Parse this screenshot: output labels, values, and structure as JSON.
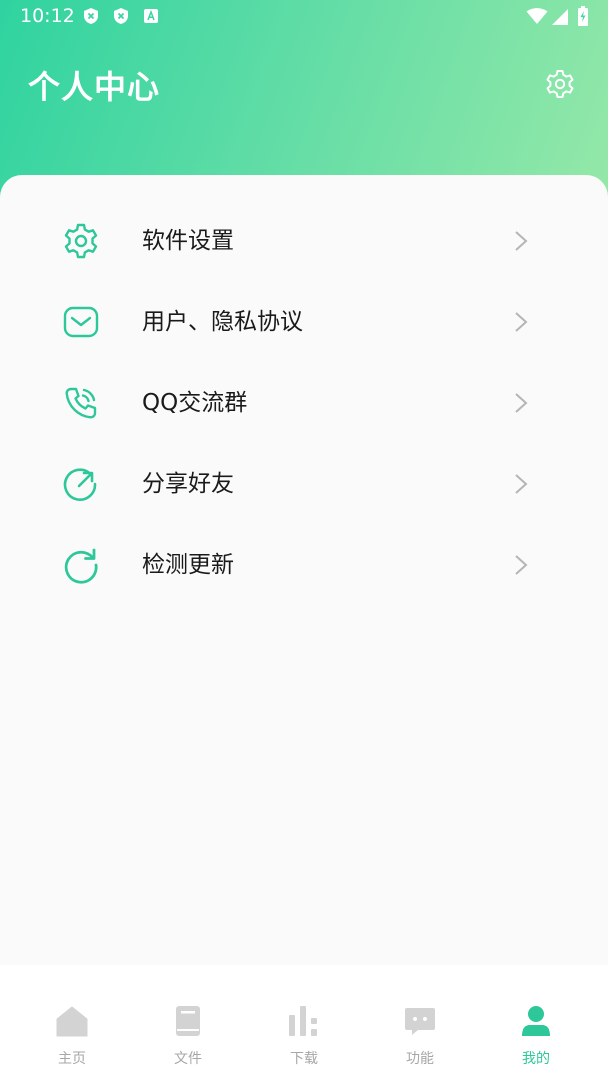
{
  "status_bar": {
    "time": "10:12",
    "notification_icons": [
      "shield-icon",
      "shield-icon",
      "a-badge-icon"
    ],
    "system_icons": [
      "wifi-icon",
      "signal-icon",
      "battery-charging-icon"
    ]
  },
  "header": {
    "title": "个人中心",
    "settings_icon": "gear-icon"
  },
  "menu": [
    {
      "label": "软件设置",
      "icon": "gear-icon"
    },
    {
      "label": "用户、隐私协议",
      "icon": "mail-icon"
    },
    {
      "label": "QQ交流群",
      "icon": "phone-icon"
    },
    {
      "label": "分享好友",
      "icon": "share-icon"
    },
    {
      "label": "检测更新",
      "icon": "refresh-icon"
    }
  ],
  "bottom_nav": [
    {
      "label": "主页",
      "icon": "home-icon",
      "active": false
    },
    {
      "label": "文件",
      "icon": "book-icon",
      "active": false
    },
    {
      "label": "下载",
      "icon": "bar-chart-icon",
      "active": false
    },
    {
      "label": "功能",
      "icon": "chat-icon",
      "active": false
    },
    {
      "label": "我的",
      "icon": "user-icon",
      "active": true
    }
  ],
  "colors": {
    "accent": "#2ec79a",
    "header_gradient_start": "#2fd3a0",
    "header_gradient_end": "#95e8a8",
    "nav_inactive": "#d3d3d3",
    "text_primary": "#1a1a1a"
  }
}
